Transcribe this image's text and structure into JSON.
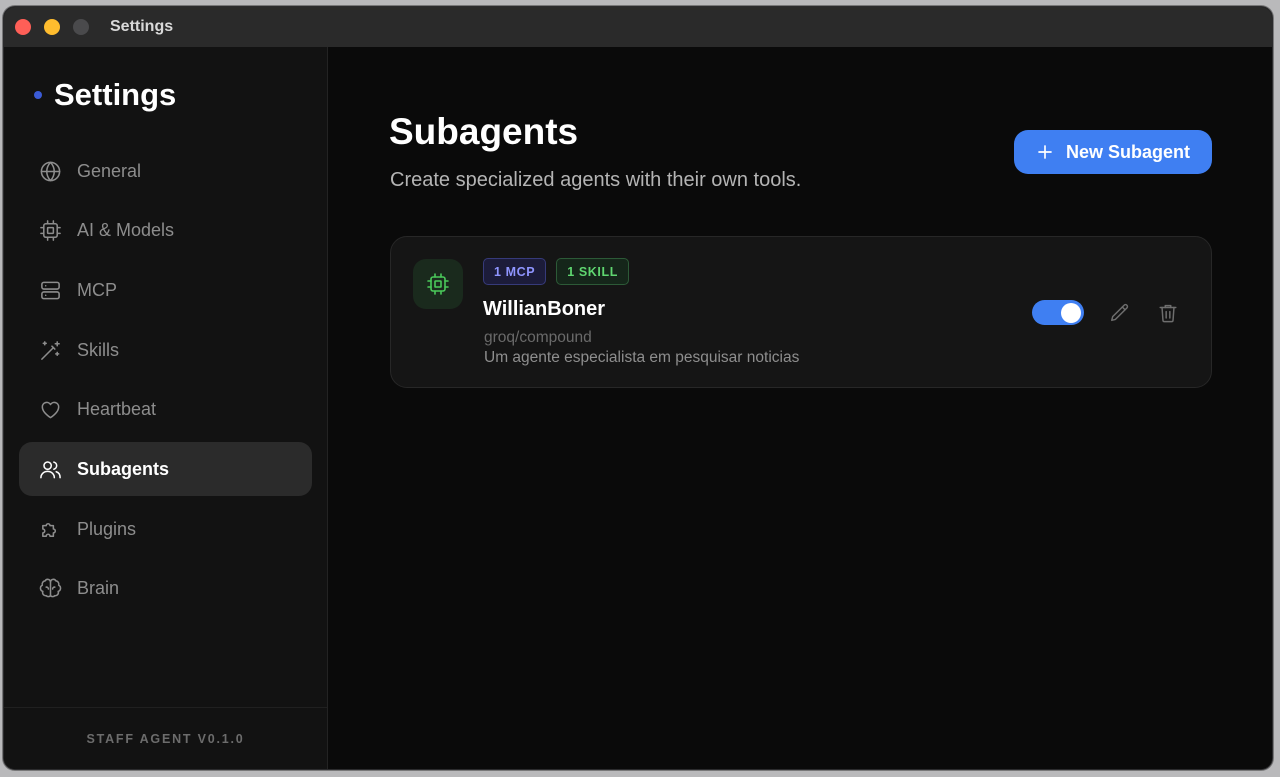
{
  "window": {
    "title": "Settings"
  },
  "sidebar": {
    "title": "Settings",
    "items": [
      {
        "label": "General",
        "icon": "globe-icon",
        "active": false
      },
      {
        "label": "AI & Models",
        "icon": "chip-icon",
        "active": false
      },
      {
        "label": "MCP",
        "icon": "server-icon",
        "active": false
      },
      {
        "label": "Skills",
        "icon": "magic-wand-icon",
        "active": false
      },
      {
        "label": "Heartbeat",
        "icon": "heart-icon",
        "active": false
      },
      {
        "label": "Subagents",
        "icon": "users-icon",
        "active": true
      },
      {
        "label": "Plugins",
        "icon": "puzzle-icon",
        "active": false
      },
      {
        "label": "Brain",
        "icon": "brain-icon",
        "active": false
      }
    ],
    "footer_version": "STAFF AGENT V0.1.0"
  },
  "main": {
    "title": "Subagents",
    "subtitle": "Create specialized agents with their own tools.",
    "new_button_label": "New Subagent",
    "agents": [
      {
        "name": "WillianBoner",
        "model": "groq/compound",
        "description": "Um agente especialista em pesquisar noticias",
        "badges": [
          "1 MCP",
          "1 SKILL"
        ],
        "enabled": true,
        "icon": "chip-icon"
      }
    ]
  },
  "colors": {
    "accent": "#3f7ff2",
    "mcp_badge": "#8f95ff",
    "skill_badge": "#5fd670",
    "agent_icon": "#4ac95a"
  }
}
